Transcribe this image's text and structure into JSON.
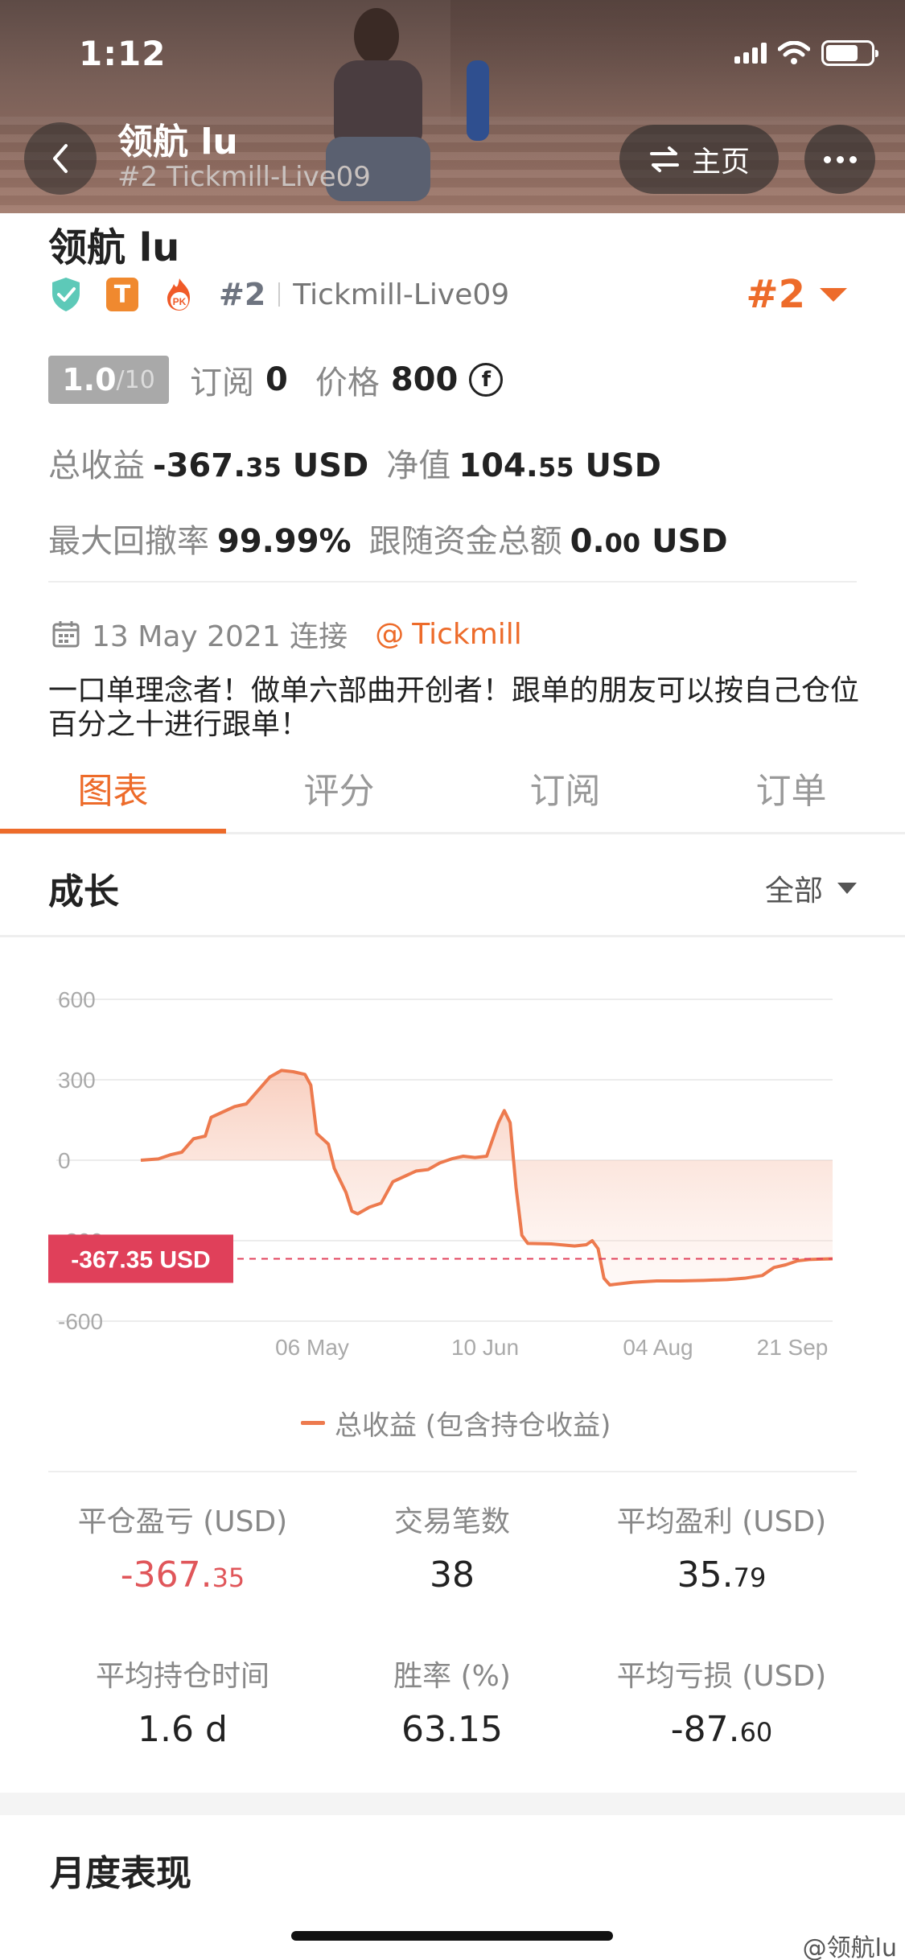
{
  "status_bar": {
    "time": "1:12"
  },
  "header": {
    "name": "领航 lu",
    "subtitle": "#2 Tickmill-Live09",
    "home_label": "主页"
  },
  "profile": {
    "name": "领航 lu",
    "badge_t": "T",
    "badge_pk": "PK",
    "rank_small": "#2",
    "server": "Tickmill-Live09",
    "rank_big": "#2",
    "score_main": "1.0",
    "score_total": "/10",
    "subscribe_label": "订阅",
    "subscribe_value": "0",
    "price_label": "价格",
    "price_value": "800",
    "coin_symbol": "f",
    "total_profit_label": "总收益",
    "total_profit_main": "-367.",
    "total_profit_dec": "35",
    "total_profit_unit": "USD",
    "equity_label": "净值",
    "equity_main": "104.",
    "equity_dec": "55",
    "equity_unit": "USD",
    "drawdown_label": "最大回撤率",
    "drawdown_value": "99.99%",
    "follow_label": "跟随资金总额",
    "follow_main": "0.",
    "follow_dec": "00",
    "follow_unit": "USD",
    "connect_text": "13 May 2021 连接",
    "broker_at": "@",
    "broker": "Tickmill",
    "bio": "一口单理念者！做单六部曲开创者！跟单的朋友可以按自己仓位百分之十进行跟单！"
  },
  "tabs": [
    "图表",
    "评分",
    "订阅",
    "订单"
  ],
  "growth": {
    "title": "成长",
    "filter": "全部"
  },
  "chart_data": {
    "type": "area",
    "x_ticks": [
      "06 May",
      "10 Jun",
      "04 Aug",
      "21 Sep"
    ],
    "y_ticks": [
      600,
      300,
      0,
      -300,
      -600
    ],
    "ylim": [
      -600,
      600
    ],
    "current_label": "-367.35 USD",
    "current_value": -367.35,
    "series": [
      {
        "name": "总收益 (包含持仓收益)",
        "color": "#ed7a4e",
        "points": [
          [
            0,
            0
          ],
          [
            3,
            5
          ],
          [
            5,
            20
          ],
          [
            7,
            30
          ],
          [
            9,
            80
          ],
          [
            11,
            90
          ],
          [
            12,
            160
          ],
          [
            14,
            180
          ],
          [
            16,
            200
          ],
          [
            18,
            210
          ],
          [
            20,
            260
          ],
          [
            22,
            310
          ],
          [
            24,
            335
          ],
          [
            26,
            330
          ],
          [
            28,
            320
          ],
          [
            29,
            280
          ],
          [
            30,
            100
          ],
          [
            32,
            60
          ],
          [
            33,
            -30
          ],
          [
            35,
            -120
          ],
          [
            36,
            -190
          ],
          [
            37,
            -200
          ],
          [
            39,
            -175
          ],
          [
            41,
            -160
          ],
          [
            43,
            -80
          ],
          [
            45,
            -60
          ],
          [
            47,
            -40
          ],
          [
            49,
            -35
          ],
          [
            51,
            -10
          ],
          [
            53,
            5
          ],
          [
            55,
            15
          ],
          [
            57,
            10
          ],
          [
            59,
            15
          ],
          [
            61,
            140
          ],
          [
            62,
            185
          ],
          [
            63,
            140
          ],
          [
            64,
            -100
          ],
          [
            65,
            -280
          ],
          [
            66,
            -310
          ],
          [
            70,
            -312
          ],
          [
            74,
            -320
          ],
          [
            76,
            -315
          ],
          [
            77,
            -300
          ],
          [
            78,
            -330
          ],
          [
            79,
            -440
          ],
          [
            80,
            -465
          ],
          [
            84,
            -455
          ],
          [
            88,
            -450
          ],
          [
            92,
            -450
          ],
          [
            96,
            -448
          ],
          [
            100,
            -445
          ],
          [
            103,
            -440
          ],
          [
            106,
            -430
          ],
          [
            108,
            -400
          ],
          [
            110,
            -390
          ],
          [
            112,
            -375
          ],
          [
            114,
            -370
          ],
          [
            118,
            -367.35
          ]
        ]
      }
    ]
  },
  "stats": [
    {
      "label": "平仓盈亏 (USD)",
      "main": "-367.",
      "dec": "35",
      "negative": true
    },
    {
      "label": "交易笔数",
      "main": "38",
      "dec": "",
      "negative": false
    },
    {
      "label": "平均盈利 (USD)",
      "main": "35.",
      "dec": "79",
      "negative": false
    },
    {
      "label": "平均持仓时间",
      "main": "1.6 d",
      "dec": "",
      "negative": false
    },
    {
      "label": "胜率 (%)",
      "main": "63.15",
      "dec": "",
      "negative": false
    },
    {
      "label": "平均亏损 (USD)",
      "main": "-87.",
      "dec": "60",
      "negative": false
    }
  ],
  "monthly": {
    "title": "月度表现"
  },
  "watermark": "@领航lu",
  "colors": {
    "accent": "#ed6b2a",
    "negative": "#e0565a",
    "line": "#ed7a4e",
    "label_bg": "#e0405a"
  }
}
